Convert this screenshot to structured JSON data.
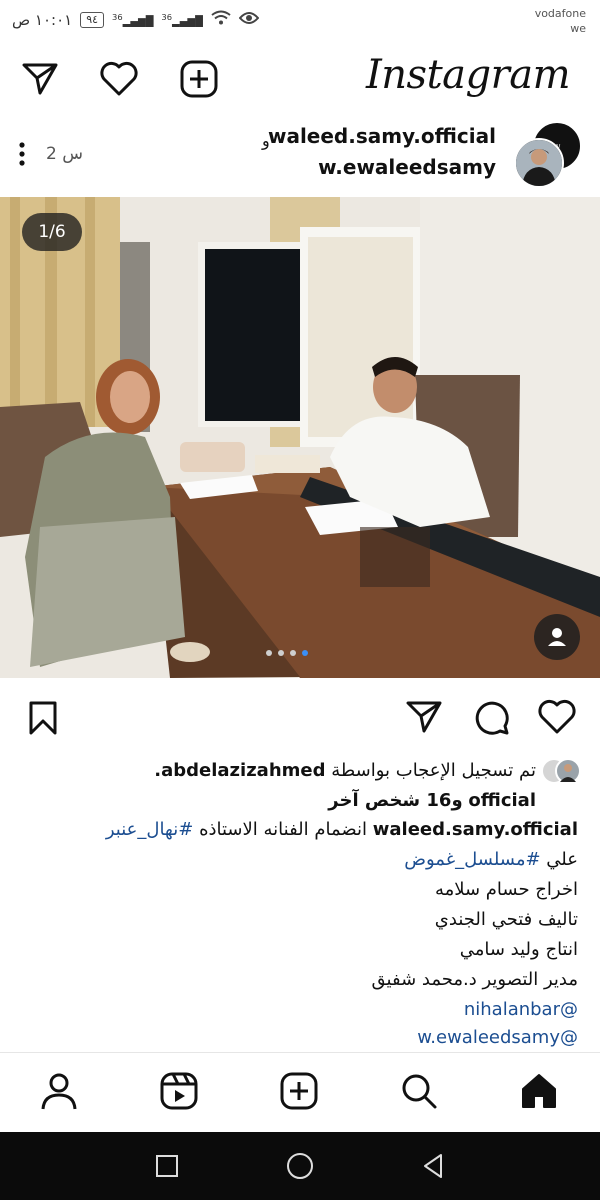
{
  "status_bar": {
    "time": "١٠:٠١ ص",
    "battery": "٩٤",
    "signal_1": "36",
    "signal_2": "36",
    "carrier_line1": "vodafone",
    "carrier_line2": "we"
  },
  "header": {
    "logo": "Instagram",
    "icons": [
      "direct-send-icon",
      "heart-icon",
      "new-post-icon"
    ]
  },
  "post": {
    "author_1": "waleed.samy.official",
    "and_word": "و",
    "author_2": "w.ewaleedsamy",
    "time_ago": "2 س",
    "page_counter": "1/6",
    "carousel_total": 4,
    "carousel_active_index": 3
  },
  "actions": {
    "icons": [
      "bookmark-icon",
      "share-icon",
      "comment-icon",
      "like-icon"
    ]
  },
  "likes": {
    "prefix": "تم تسجيل الإعجاب بواسطة",
    "user": "abdelazizahmed.",
    "line2_user_end": "official",
    "line2_rest": "و16 شخص آخر"
  },
  "caption": {
    "username": "waleed.samy.official",
    "text": "انضمام الفنانه الاستاذه",
    "hashtag_1": "#نهال_عنبر",
    "line2_prefix": "علي",
    "hashtag_2": "#مسلسل_غموض",
    "line3": "اخراج حسام سلامه",
    "line4": "تاليف فتحي الجندي",
    "line5": "انتاج وليد سامي",
    "line6": "مدير التصوير د.محمد شفيق",
    "mention_1": "nihalanbar@",
    "mention_2": "w.ewaleedsamy@"
  },
  "bottom_nav": {
    "items": [
      "profile-icon",
      "reels-icon",
      "create-icon",
      "search-icon",
      "home-icon"
    ]
  },
  "system_nav": {
    "items": [
      "recents-button",
      "home-button",
      "back-button"
    ]
  },
  "colors": {
    "link": "#1c4e91",
    "carousel_active": "#3a8ff7",
    "system_bar": "#0b0b0b"
  }
}
